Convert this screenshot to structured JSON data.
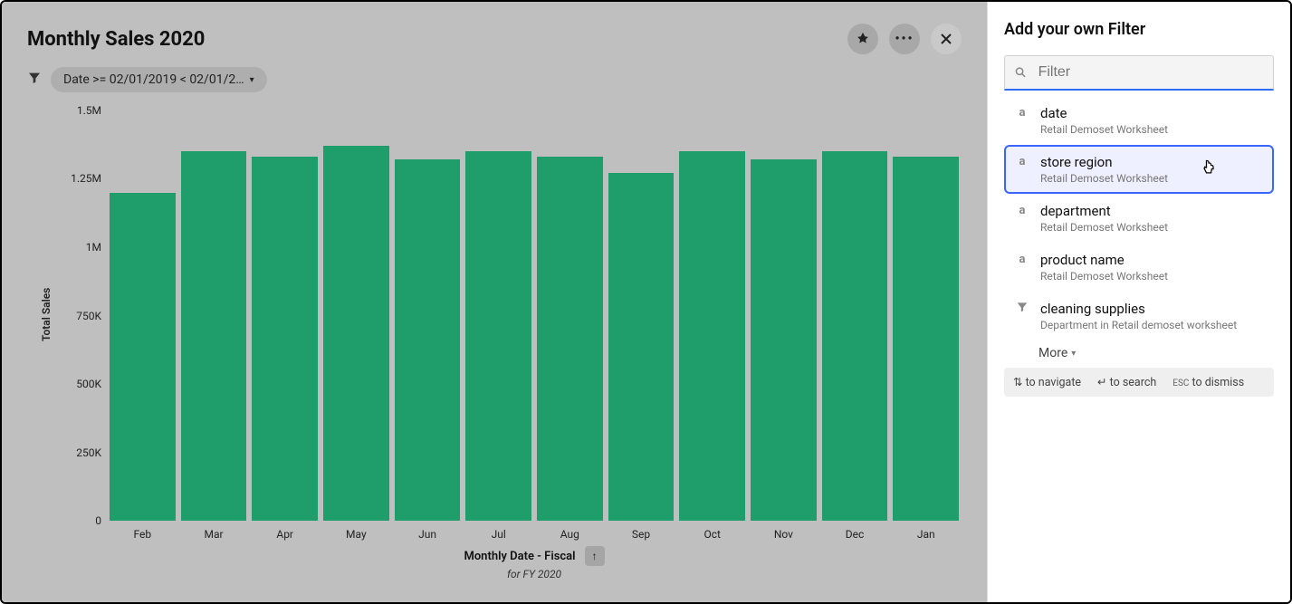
{
  "main": {
    "title": "Monthly Sales 2020",
    "filter_label": "Date >= 02/01/2019 < 02/01/2…",
    "axis_y_label": "Total Sales",
    "axis_x_label": "Monthly Date - Fiscal",
    "axis_x_sub": "for FY 2020"
  },
  "side": {
    "title": "Add your own Filter",
    "search_placeholder": "Filter",
    "results": [
      {
        "type": "a",
        "name": "date",
        "sub": "Retail Demoset Worksheet"
      },
      {
        "type": "a",
        "name": "store region",
        "sub": "Retail Demoset Worksheet",
        "selected": true
      },
      {
        "type": "a",
        "name": "department",
        "sub": "Retail Demoset Worksheet"
      },
      {
        "type": "a",
        "name": "product name",
        "sub": "Retail Demoset Worksheet"
      },
      {
        "type": "filter",
        "name": "cleaning supplies",
        "sub": "Department in Retail demoset worksheet"
      }
    ],
    "more_label": "More",
    "hints": {
      "navigate": "to navigate",
      "search": "to search",
      "dismiss": "to dismiss",
      "esc": "ESC"
    }
  },
  "chart_data": {
    "type": "bar",
    "categories": [
      "Feb",
      "Mar",
      "Apr",
      "May",
      "Jun",
      "Jul",
      "Aug",
      "Sep",
      "Oct",
      "Nov",
      "Dec",
      "Jan"
    ],
    "values": [
      1200000,
      1350000,
      1330000,
      1370000,
      1320000,
      1350000,
      1330000,
      1270000,
      1350000,
      1320000,
      1350000,
      1330000
    ],
    "title": "Monthly Sales 2020",
    "xlabel": "Monthly Date - Fiscal",
    "ylabel": "Total Sales",
    "ylim": [
      0,
      1500000
    ],
    "y_ticks": [
      {
        "v": 1500000,
        "label": "1.5M"
      },
      {
        "v": 1250000,
        "label": "1.25M"
      },
      {
        "v": 1000000,
        "label": "1M"
      },
      {
        "v": 750000,
        "label": "750K"
      },
      {
        "v": 500000,
        "label": "500K"
      },
      {
        "v": 250000,
        "label": "250K"
      },
      {
        "v": 0,
        "label": "0"
      }
    ]
  }
}
